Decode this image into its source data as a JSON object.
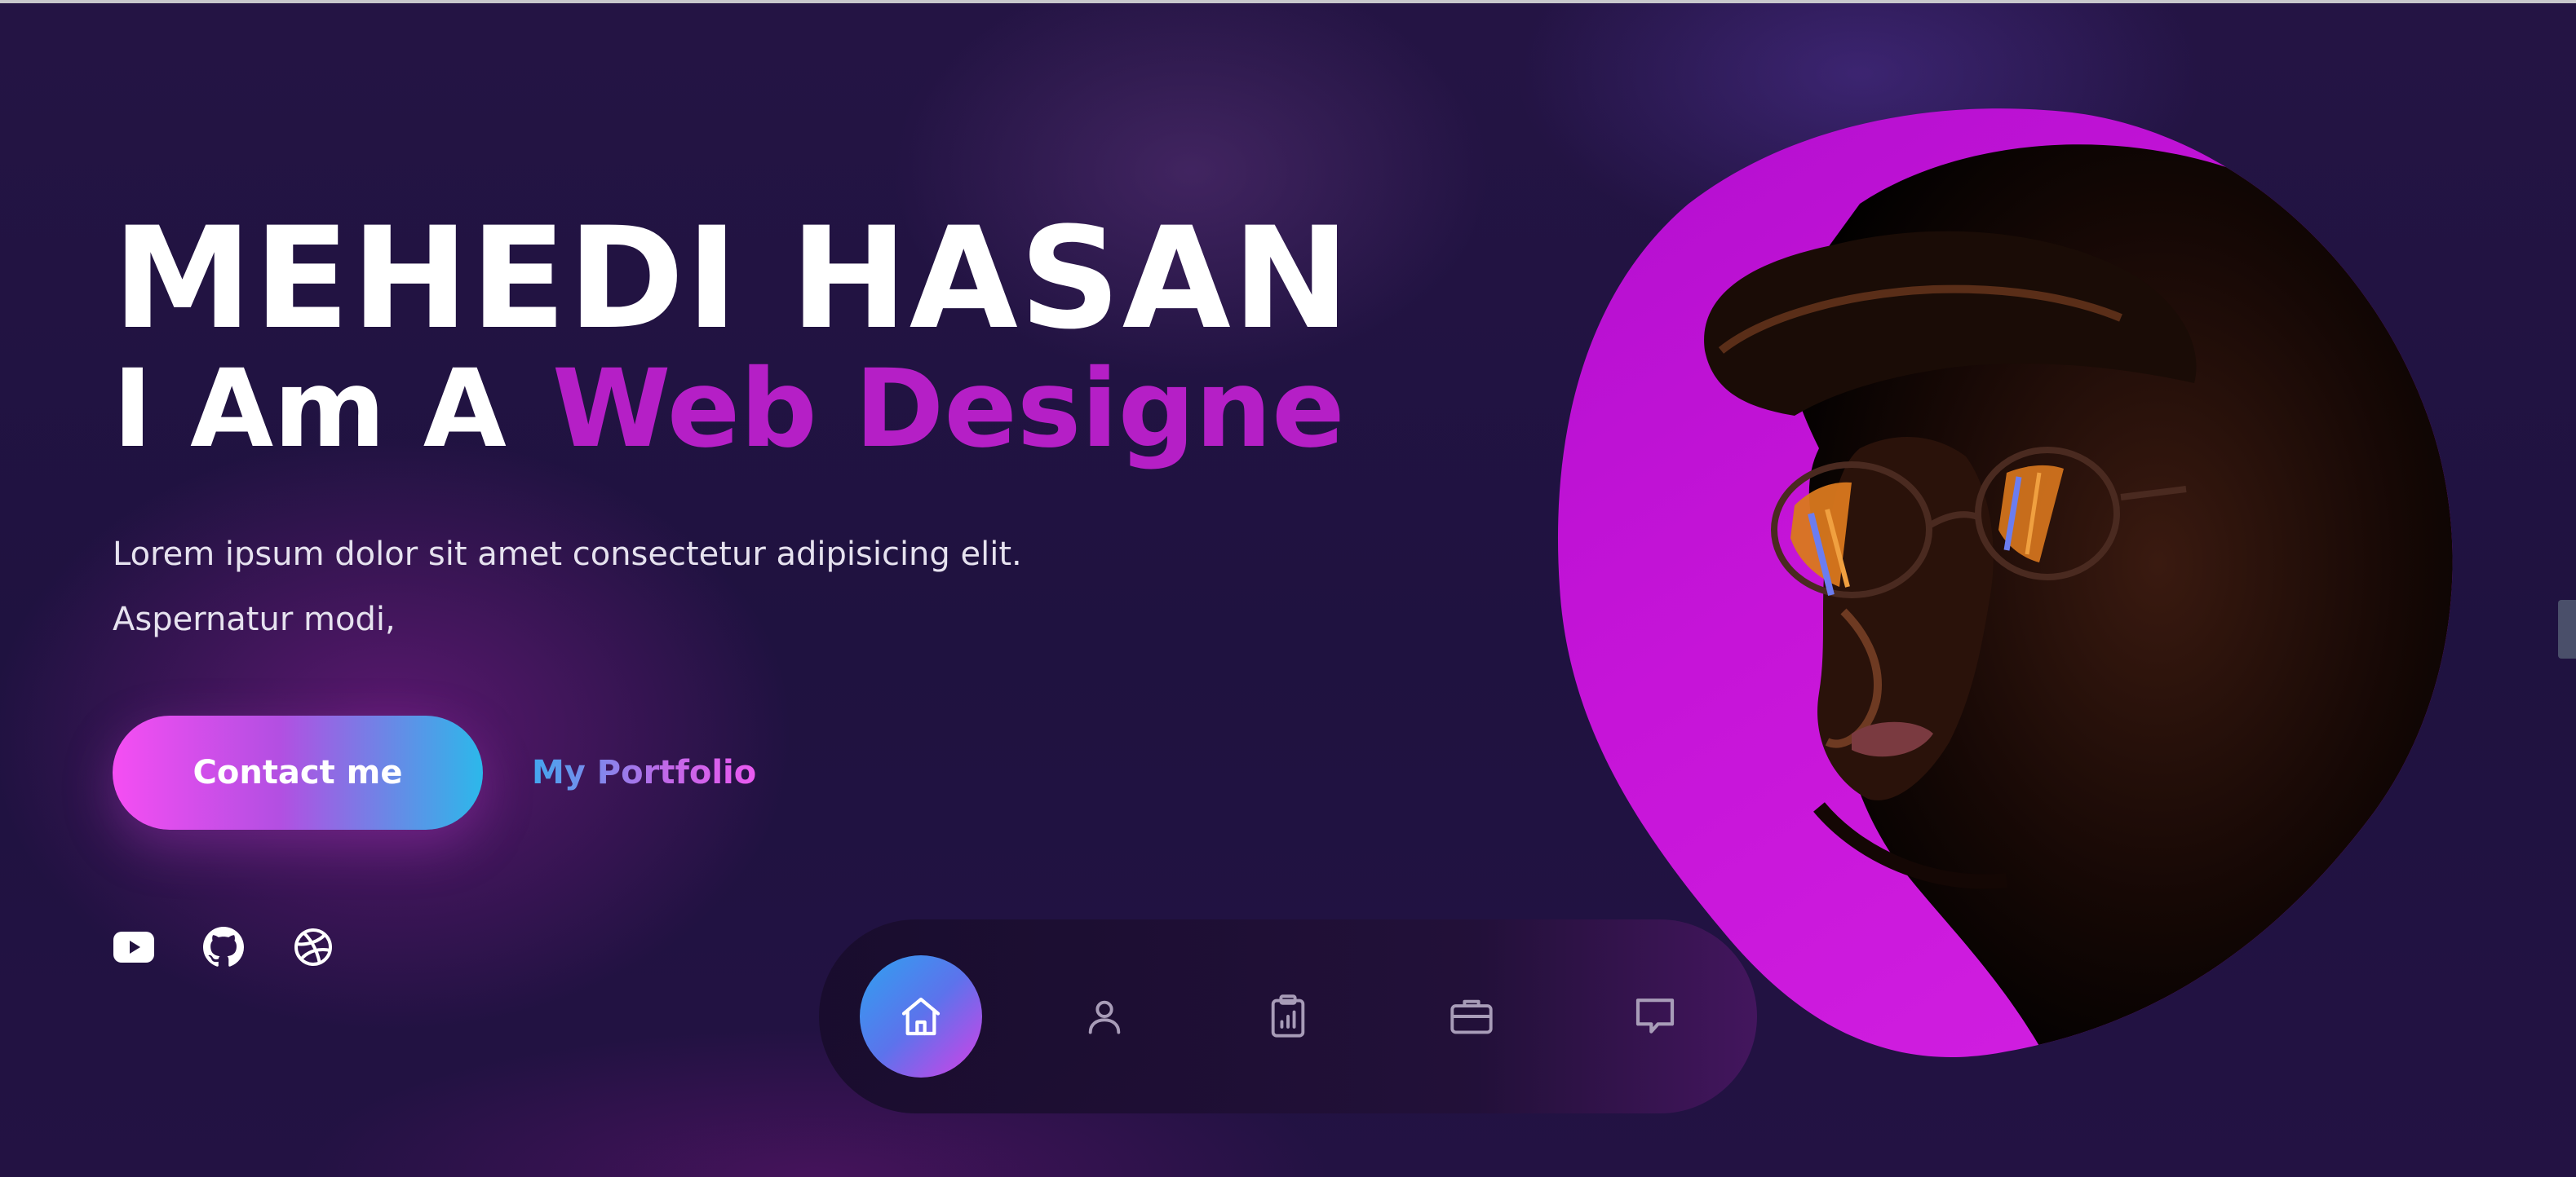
{
  "hero": {
    "name": "MEHEDI HASAN",
    "subtitle_prefix": "I Am A",
    "subtitle_typed": "Web Designe",
    "description": "Lorem ipsum dolor sit amet consectetur adipisicing elit. Aspernatur modi,"
  },
  "actions": {
    "contact_label": "Contact me",
    "portfolio_label": "My Portfolio"
  },
  "social": [
    {
      "icon": "youtube-icon"
    },
    {
      "icon": "github-icon"
    },
    {
      "icon": "dribbble-icon"
    }
  ],
  "bottom_nav": {
    "items": [
      {
        "icon": "home-icon",
        "active": true
      },
      {
        "icon": "user-icon",
        "active": false
      },
      {
        "icon": "clipboard-chart-icon",
        "active": false
      },
      {
        "icon": "briefcase-icon",
        "active": false
      },
      {
        "icon": "chat-icon",
        "active": false
      }
    ]
  },
  "colors": {
    "background": "#22123f",
    "accent_magenta": "#b51fc6",
    "blob": "#c414d6",
    "button_gradient_start": "#f54ef3",
    "button_gradient_end": "#2cb8ea"
  }
}
